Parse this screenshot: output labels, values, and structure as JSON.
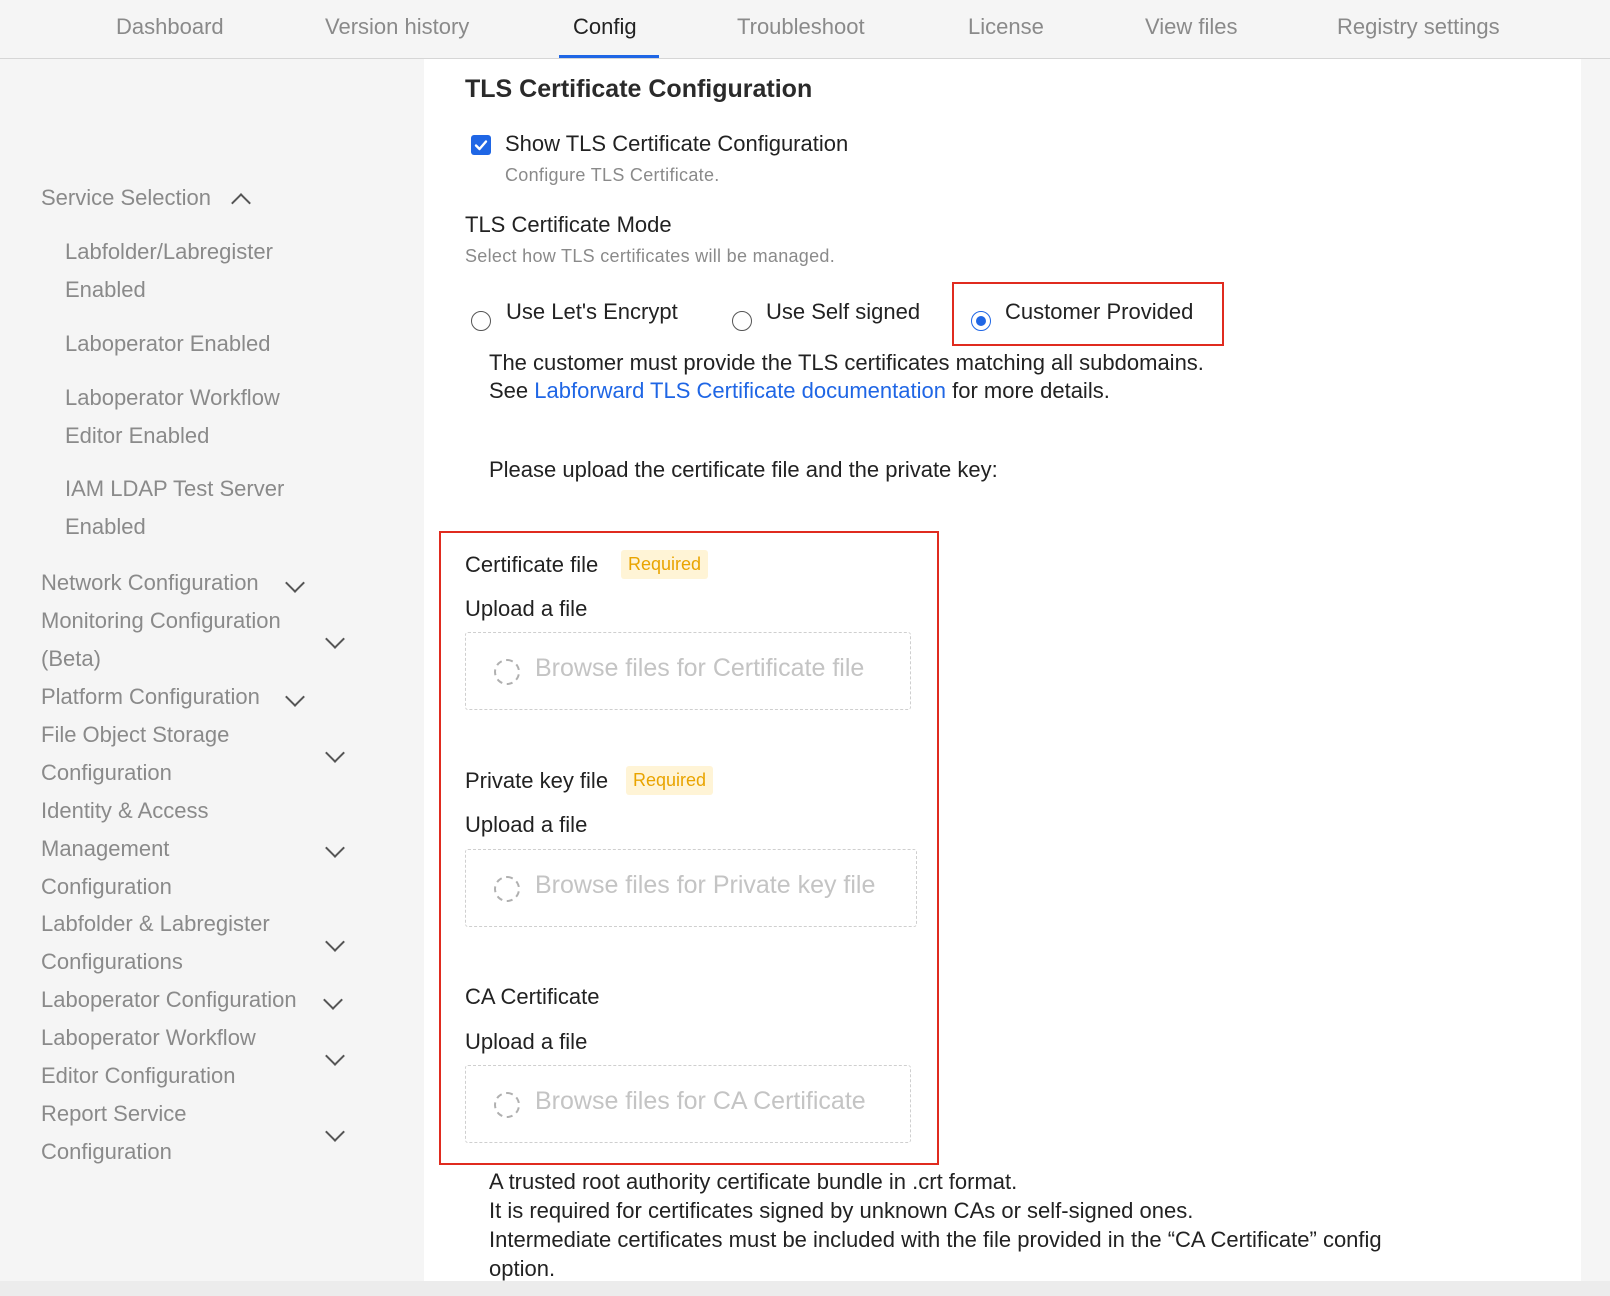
{
  "tabs": [
    {
      "label": "Dashboard"
    },
    {
      "label": "Version history"
    },
    {
      "label": "Config"
    },
    {
      "label": "Troubleshoot"
    },
    {
      "label": "License"
    },
    {
      "label": "View files"
    },
    {
      "label": "Registry settings"
    }
  ],
  "active_tab": "Config",
  "sidebar": {
    "service_selection": "Service Selection",
    "sub_items": [
      {
        "line1": "Labfolder/Labregister",
        "line2": "Enabled"
      },
      {
        "line1": "Laboperator Enabled"
      },
      {
        "line1": "Laboperator Workflow",
        "line2": "Editor Enabled"
      },
      {
        "line1": "IAM LDAP Test Server",
        "line2": "Enabled"
      }
    ],
    "groups": [
      {
        "line1": "Network Configuration"
      },
      {
        "line1": "Monitoring Configuration",
        "line2": "(Beta)"
      },
      {
        "line1": "Platform Configuration"
      },
      {
        "line1": "File Object Storage",
        "line2": "Configuration"
      },
      {
        "line1": "Identity & Access",
        "line2": "Management",
        "line3": "Configuration"
      },
      {
        "line1": "Labfolder & Labregister",
        "line2": "Configurations"
      },
      {
        "line1": "Laboperator Configuration"
      },
      {
        "line1": "Laboperator Workflow",
        "line2": "Editor Configuration"
      },
      {
        "line1": "Report Service",
        "line2": "Configuration"
      }
    ]
  },
  "main": {
    "section_title": "TLS Certificate Configuration",
    "show_tls": {
      "label": "Show TLS Certificate Configuration",
      "help": "Configure TLS Certificate.",
      "checked": true
    },
    "mode": {
      "label": "TLS Certificate Mode",
      "help": "Select how TLS certificates will be managed.",
      "options": [
        {
          "label": "Use Let's Encrypt",
          "selected": false
        },
        {
          "label": "Use Self signed",
          "selected": false
        },
        {
          "label": "Customer Provided",
          "selected": true
        }
      ]
    },
    "customer_note_line1": "The customer must provide the TLS certificates matching all subdomains.",
    "customer_note_see": "See ",
    "customer_note_link": "Labforward TLS Certificate documentation",
    "customer_note_tail": " for more details.",
    "upload_prompt": "Please upload the certificate file and the private key:",
    "files": [
      {
        "label": "Certificate file",
        "badge": "Required",
        "upload_label": "Upload a file",
        "browse": "Browse files for Certificate file"
      },
      {
        "label": "Private key file",
        "badge": "Required",
        "upload_label": "Upload a file",
        "browse": "Browse files for Private key file"
      },
      {
        "label": "CA Certificate",
        "badge": "",
        "upload_label": "Upload a file",
        "browse": "Browse files for CA Certificate"
      }
    ],
    "ca_help_lines": [
      "A trusted root authority certificate bundle in .crt format.",
      "It is required for certificates signed by unknown CAs or self-signed ones.",
      "Intermediate certificates must be included with the file provided in the “CA Certificate” config",
      "option."
    ]
  },
  "colors": {
    "accent": "#1f66e5",
    "highlight": "#e02b1f",
    "badge_bg": "#fff4d6",
    "badge_text": "#e9a400"
  }
}
